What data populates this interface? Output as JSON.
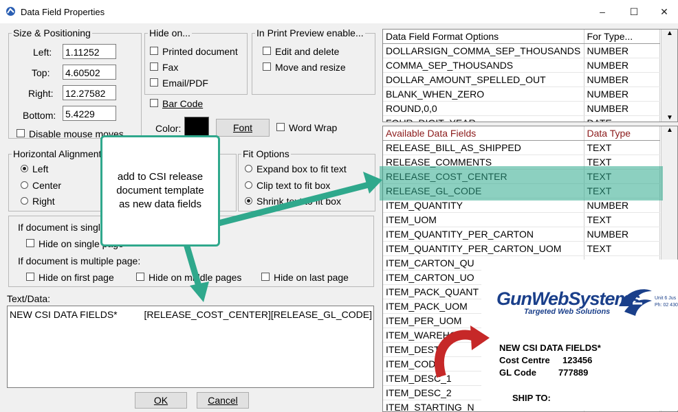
{
  "window": {
    "title": "Data Field Properties",
    "minimize": "–",
    "maximize": "☐",
    "close": "✕"
  },
  "size_pos": {
    "legend": "Size & Positioning",
    "left_label": "Left:",
    "left_value": "1.11252",
    "top_label": "Top:",
    "top_value": "4.60502",
    "right_label": "Right:",
    "right_value": "12.27582",
    "bottom_label": "Bottom:",
    "bottom_value": "5.4229",
    "disable_mouse": "Disable mouse moves"
  },
  "hide_on": {
    "legend": "Hide on...",
    "printed": "Printed document",
    "fax": "Fax",
    "email": "Email/PDF"
  },
  "print_preview": {
    "legend": "In Print Preview enable...",
    "edit_delete": "Edit and delete",
    "move_resize": "Move and resize"
  },
  "barcode": "Bar Code",
  "color_label": "Color:",
  "color_value": "#000000",
  "font_button": "Font",
  "word_wrap": "Word Wrap",
  "horiz": {
    "legend": "Horizontal Alignment",
    "left": "Left",
    "center": "Center",
    "right": "Right"
  },
  "fit": {
    "legend": "Fit Options",
    "expand": "Expand box to fit text",
    "clip": "Clip text to fit box",
    "shrink": "Shrink text to fit box"
  },
  "single_page": {
    "label": "If document is single page:",
    "hide": "Hide on single page"
  },
  "multi_page": {
    "label": "If document is multiple page:",
    "first": "Hide on first page",
    "middle": "Hide on middle pages",
    "last": "Hide on last page"
  },
  "text_data": {
    "label": "Text/Data:",
    "value": "NEW CSI DATA FIELDS*          [RELEASE_COST_CENTER][RELEASE_GL_CODE]"
  },
  "ok_button": "OK",
  "cancel_button": "Cancel",
  "format_grid": {
    "headers": [
      "Data Field Format Options",
      "For Type..."
    ],
    "rows": [
      [
        "DOLLARSIGN_COMMA_SEP_THOUSANDS",
        "NUMBER"
      ],
      [
        "COMMA_SEP_THOUSANDS",
        "NUMBER"
      ],
      [
        "DOLLAR_AMOUNT_SPELLED_OUT",
        "NUMBER"
      ],
      [
        "BLANK_WHEN_ZERO",
        "NUMBER"
      ],
      [
        "ROUND,0,0",
        "NUMBER"
      ],
      [
        "FOUR_DIGIT_YEAR",
        "DATE"
      ]
    ]
  },
  "fields_grid": {
    "headers": [
      "Available Data Fields",
      "Data Type"
    ],
    "rows": [
      [
        "RELEASE_BILL_AS_SHIPPED",
        "TEXT"
      ],
      [
        "RELEASE_COMMENTS",
        "TEXT"
      ],
      [
        "RELEASE_COST_CENTER",
        "TEXT"
      ],
      [
        "RELEASE_GL_CODE",
        "TEXT"
      ],
      [
        "ITEM_QUANTITY",
        "NUMBER"
      ],
      [
        "ITEM_UOM",
        "TEXT"
      ],
      [
        "ITEM_QUANTITY_PER_CARTON",
        "NUMBER"
      ],
      [
        "ITEM_QUANTITY_PER_CARTON_UOM",
        "TEXT"
      ],
      [
        "ITEM_CARTON_QU",
        ""
      ],
      [
        "ITEM_CARTON_UO",
        ""
      ],
      [
        "ITEM_PACK_QUANT",
        ""
      ],
      [
        "ITEM_PACK_UOM",
        ""
      ],
      [
        "ITEM_PER_UOM",
        ""
      ],
      [
        "ITEM_WAREHOUSE",
        ""
      ],
      [
        "ITEM_DEST",
        ""
      ],
      [
        "ITEM_CODE",
        ""
      ],
      [
        "ITEM_DESC_1",
        ""
      ],
      [
        "ITEM_DESC_2",
        ""
      ],
      [
        "ITEM_STARTING_N",
        ""
      ]
    ]
  },
  "callout": {
    "line1": "add to CSI release",
    "line2": "document template",
    "line3": "as new data fields"
  },
  "preview": {
    "logo_main": "GunWebSystems",
    "logo_sub": "Targeted Web Solutions",
    "addr1": "Unit 6 Jus",
    "addr2": "Ph: 02 430",
    "heading": "NEW CSI DATA FIELDS*",
    "cost_label": "Cost Centre",
    "cost_value": "123456",
    "gl_label": "GL Code",
    "gl_value": "777889",
    "ship_to": "SHIP TO:"
  },
  "colors": {
    "accent": "#2fa88c",
    "arrow_red": "#c62828",
    "logo_blue": "#1a3f8a"
  }
}
